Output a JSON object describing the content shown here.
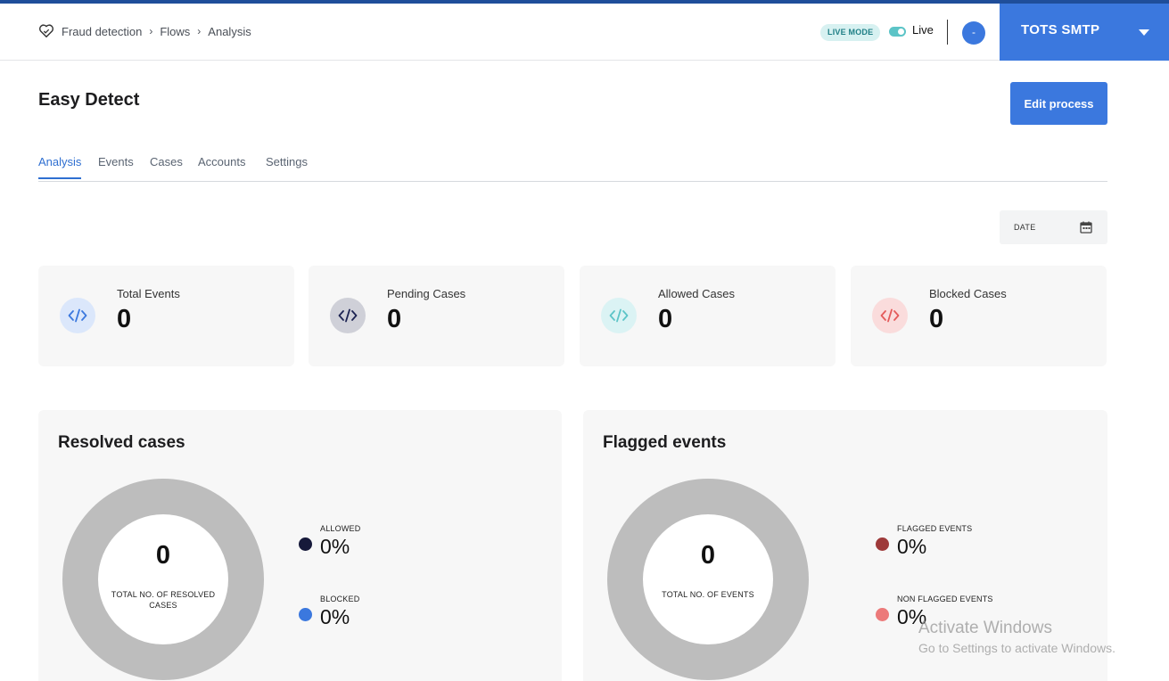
{
  "breadcrumb": {
    "items": [
      "Fraud detection",
      "Flows",
      "Analysis"
    ]
  },
  "header": {
    "mode_badge": "LIVE MODE",
    "live_label": "Live",
    "avatar_initial": "-",
    "account_name": "TOTS SMTP"
  },
  "page": {
    "title": "Easy Detect",
    "edit_button": "Edit process"
  },
  "tabs": [
    {
      "label": "Analysis",
      "active": true
    },
    {
      "label": "Events"
    },
    {
      "label": "Cases"
    },
    {
      "label": "Accounts"
    },
    {
      "label": "Settings"
    }
  ],
  "date_filter": {
    "label": "DATE"
  },
  "stats": [
    {
      "label": "Total Events",
      "value": "0",
      "color": "#3b78de"
    },
    {
      "label": "Pending Cases",
      "value": "0",
      "color": "#1d2453"
    },
    {
      "label": "Allowed Cases",
      "value": "0",
      "color": "#5cc4c7"
    },
    {
      "label": "Blocked Cases",
      "value": "0",
      "color": "#e45a5a"
    }
  ],
  "resolved": {
    "title": "Resolved cases",
    "total": "0",
    "caption": "TOTAL NO. OF RESOLVED CASES",
    "legend": [
      {
        "label": "ALLOWED",
        "value": "0%",
        "color": "#16193a"
      },
      {
        "label": "BLOCKED",
        "value": "0%",
        "color": "#3b78de"
      }
    ]
  },
  "flagged": {
    "title": "Flagged events",
    "total": "0",
    "caption": "TOTAL NO. OF EVENTS",
    "legend": [
      {
        "label": "FLAGGED EVENTS",
        "value": "0%",
        "color": "#9e3a3a"
      },
      {
        "label": "NON FLAGGED EVENTS",
        "value": "0%",
        "color": "#ec7a7a"
      }
    ]
  },
  "watermark": {
    "line1": "Activate Windows",
    "line2": "Go to Settings to activate Windows."
  }
}
